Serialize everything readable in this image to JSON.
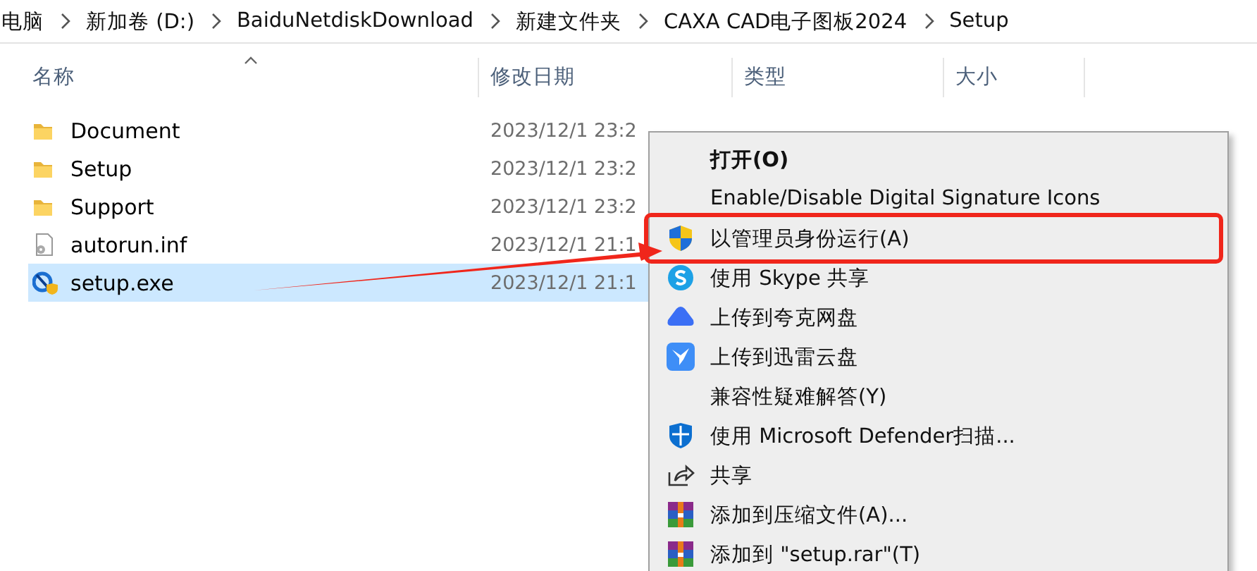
{
  "breadcrumb": [
    "电脑",
    "新加卷 (D:)",
    "BaiduNetdiskDownload",
    "新建文件夹",
    "CAXA CAD电子图板2024",
    "Setup"
  ],
  "columns": [
    {
      "label": "名称",
      "sorted": true
    },
    {
      "label": "修改日期",
      "sorted": false
    },
    {
      "label": "类型",
      "sorted": false
    },
    {
      "label": "大小",
      "sorted": false
    }
  ],
  "files": [
    {
      "kind": "folder",
      "name": "Document",
      "date": "2023/12/1 23:2",
      "selected": false
    },
    {
      "kind": "folder",
      "name": "Setup",
      "date": "2023/12/1 23:2",
      "selected": false
    },
    {
      "kind": "folder",
      "name": "Support",
      "date": "2023/12/1 23:2",
      "selected": false
    },
    {
      "kind": "settings",
      "name": "autorun.inf",
      "date": "2023/12/1 21:1",
      "selected": false
    },
    {
      "kind": "exe",
      "name": "setup.exe",
      "date": "2023/12/1 21:1",
      "selected": true
    }
  ],
  "context_menu": [
    {
      "kind": "plain",
      "label": "打开(O)",
      "default": true,
      "highlighted": false
    },
    {
      "kind": "plain",
      "label": "Enable/Disable Digital Signature Icons",
      "default": false,
      "highlighted": false
    },
    {
      "kind": "uac",
      "label": "以管理员身份运行(A)",
      "default": false,
      "highlighted": true
    },
    {
      "kind": "skype",
      "label": "使用 Skype 共享",
      "default": false,
      "highlighted": false
    },
    {
      "kind": "cloud",
      "label": "上传到夸克网盘",
      "default": false,
      "highlighted": false
    },
    {
      "kind": "bird",
      "label": "上传到迅雷云盘",
      "default": false,
      "highlighted": false
    },
    {
      "kind": "plain",
      "label": "兼容性疑难解答(Y)",
      "default": false,
      "highlighted": false
    },
    {
      "kind": "defender",
      "label": "使用 Microsoft Defender扫描...",
      "default": false,
      "highlighted": false
    },
    {
      "kind": "share",
      "label": "共享",
      "default": false,
      "highlighted": false
    },
    {
      "kind": "archive",
      "label": "添加到压缩文件(A)...",
      "default": false,
      "highlighted": false
    },
    {
      "kind": "archive",
      "label": "添加到 \"setup.rar\"(T)",
      "default": false,
      "highlighted": false
    }
  ]
}
